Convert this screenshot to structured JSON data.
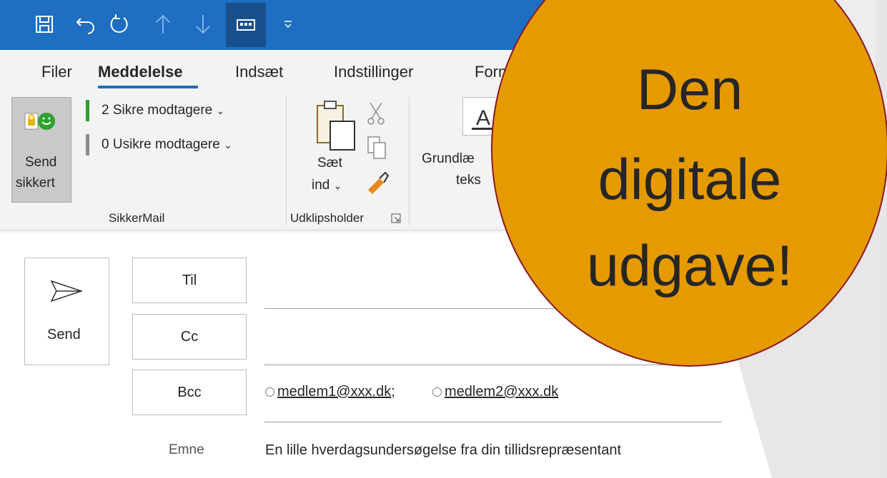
{
  "quick_access": {
    "icons": [
      "save-icon",
      "undo-icon",
      "redo-icon",
      "up-arrow-icon",
      "down-arrow-icon",
      "keyboard-icon",
      "customize-qat-icon"
    ]
  },
  "tabs": [
    "Filer",
    "Meddelelse",
    "Indsæt",
    "Indstillinger",
    "Form"
  ],
  "active_tab": "Meddelelse",
  "ribbon": {
    "sikkermail": {
      "send_label_1": "Send",
      "send_label_2": "sikkert",
      "safe_recipients": "2 Sikre modtagere",
      "unsafe_recipients": "0 Usikre modtagere",
      "group_label": "SikkerMail"
    },
    "clipboard": {
      "paste_label_1": "Sæt",
      "paste_label_2": "ind",
      "group_label": "Udklipsholder"
    },
    "basic_text": {
      "label_1": "Grundlæ",
      "label_2": "teks"
    }
  },
  "compose": {
    "send_label": "Send",
    "to_label": "Til",
    "cc_label": "Cc",
    "bcc_label": "Bcc",
    "bcc_recipients": [
      "medlem1@xxx.dk",
      "medlem2@xxx.dk"
    ],
    "subject_label": "Emne",
    "subject_value": "En lille hverdagsundersøgelse fra din tillidsrepræsentant"
  },
  "overlay": {
    "line_1": "Den",
    "line_2": "digitale",
    "line_3": "udgave!"
  },
  "colors": {
    "titlebar": "#1e6ec2",
    "badge": "#e59a00",
    "badge_border": "#8a1a2a",
    "safe_bar": "#2ea12e",
    "unsafe_bar": "#8c8c8c"
  }
}
